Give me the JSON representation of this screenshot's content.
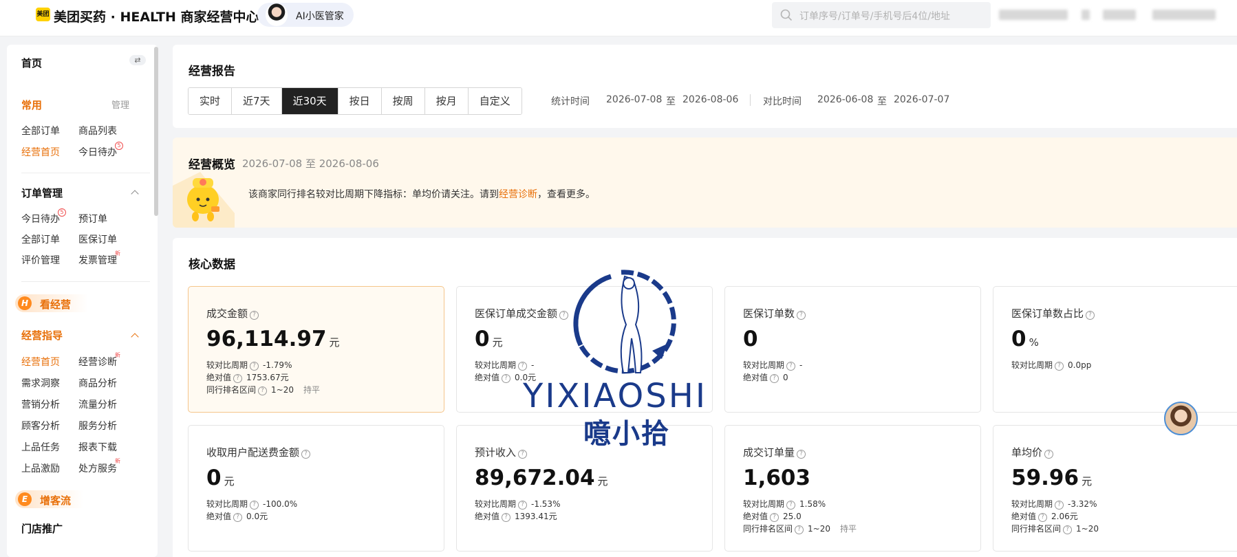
{
  "header": {
    "logo_text": "美团",
    "app_title": "美团买药 · HEALTH 商家经营中心",
    "ai_assistant_label": "AI小医管家",
    "search_placeholder": "订单序号/订单号/手机号后4位/地址"
  },
  "sidebar": {
    "home": "首页",
    "swap_icon": "⇄",
    "common": {
      "title": "常用",
      "manage": "管理",
      "items": [
        "全部订单",
        "商品列表",
        "经营首页",
        "今日待办"
      ],
      "todo_badge": "5"
    },
    "orders": {
      "title": "订单管理",
      "items": [
        "今日待办",
        "预订单",
        "全部订单",
        "医保订单",
        "评价管理",
        "发票管理"
      ],
      "todo_badge": "5",
      "new_tag": "新"
    },
    "kanjingying": {
      "title": "看经营",
      "icon": "H"
    },
    "guide": {
      "title": "经营指导",
      "items": [
        "经营首页",
        "经营诊断",
        "需求洞察",
        "商品分析",
        "营销分析",
        "流量分析",
        "顾客分析",
        "服务分析",
        "上品任务",
        "报表下载",
        "上品激励",
        "处方服务"
      ],
      "new_tag": "新"
    },
    "zengkeliu": {
      "title": "增客流",
      "icon": "E"
    },
    "store_promo": "门店推广"
  },
  "report": {
    "title": "经营报告",
    "tabs": [
      "实时",
      "近7天",
      "近30天",
      "按日",
      "按周",
      "按月",
      "自定义"
    ],
    "active_tab": "近30天",
    "stat_label": "统计时间",
    "stat_start": "2026-07-08",
    "to": "至",
    "stat_end": "2026-08-06",
    "compare_label": "对比时间",
    "compare_start": "2026-06-08",
    "compare_end": "2026-07-07"
  },
  "overview": {
    "title": "经营概览",
    "date_range": "2026-07-08 至 2026-08-06",
    "message_prefix": "该商家同行排名较对比周期下降指标：单均价请关注。请到",
    "message_link": "经营诊断",
    "message_suffix": "，查看更多。"
  },
  "core": {
    "title": "核心数据",
    "help_icon": "?",
    "cards": [
      {
        "title": "成交金额",
        "value": "96,114.97",
        "unit": "元",
        "rows": [
          {
            "label": "较对比周期",
            "value": "-1.79%"
          },
          {
            "label": "绝对值",
            "value": "1753.67元"
          },
          {
            "label": "同行排名区间",
            "value": "1~20",
            "tag": "持平"
          }
        ]
      },
      {
        "title": "医保订单成交金额",
        "value": "0",
        "unit": "元",
        "rows": [
          {
            "label": "较对比周期",
            "value": "-"
          },
          {
            "label": "绝对值",
            "value": "0.0元"
          }
        ]
      },
      {
        "title": "医保订单数",
        "value": "0",
        "unit": "",
        "rows": [
          {
            "label": "较对比周期",
            "value": "-"
          },
          {
            "label": "绝对值",
            "value": "0"
          }
        ]
      },
      {
        "title": "医保订单数占比",
        "value": "0",
        "unit": "%",
        "rows": [
          {
            "label": "较对比周期",
            "value": "0.0pp"
          }
        ]
      },
      {
        "title": "收取用户配送费金额",
        "value": "0",
        "unit": "元",
        "rows": [
          {
            "label": "较对比周期",
            "value": "-100.0%"
          },
          {
            "label": "绝对值",
            "value": "0.0元"
          }
        ]
      },
      {
        "title": "预计收入",
        "value": "89,672.04",
        "unit": "元",
        "rows": [
          {
            "label": "较对比周期",
            "value": "-1.53%"
          },
          {
            "label": "绝对值",
            "value": "1393.41元"
          }
        ]
      },
      {
        "title": "成交订单量",
        "value": "1,603",
        "unit": "",
        "rows": [
          {
            "label": "较对比周期",
            "value": "1.58%"
          },
          {
            "label": "绝对值",
            "value": "25.0"
          },
          {
            "label": "同行排名区间",
            "value": "1~20",
            "tag": "持平"
          }
        ]
      },
      {
        "title": "单均价",
        "value": "59.96",
        "unit": "元",
        "rows": [
          {
            "label": "较对比周期",
            "value": "-3.32%"
          },
          {
            "label": "绝对值",
            "value": "2.06元"
          },
          {
            "label": "同行排名区间",
            "value": "1~20"
          }
        ]
      }
    ]
  },
  "watermark": {
    "latin": "YIXIAOSHI",
    "chinese": "噫小拾",
    "color": "#1a3a8a"
  },
  "colors": {
    "accent": "#e8700a",
    "active_tab_bg": "#222222",
    "highlight_border": "#f5c58a"
  }
}
